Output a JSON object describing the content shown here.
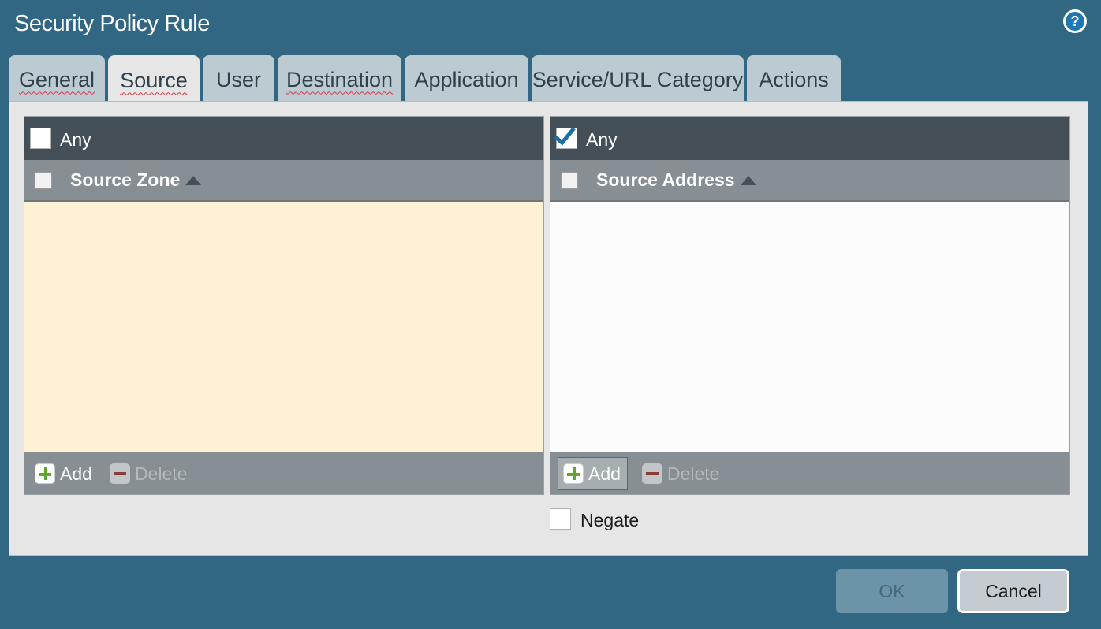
{
  "dialog": {
    "title": "Security Policy Rule"
  },
  "icons": {
    "help": "question-circle",
    "add": "plus",
    "delete": "minus",
    "sort": "triangle-up"
  },
  "tabs": [
    {
      "label": "General",
      "active": false,
      "has_error": true
    },
    {
      "label": "Source",
      "active": true,
      "has_error": true
    },
    {
      "label": "User",
      "active": false,
      "has_error": false
    },
    {
      "label": "Destination",
      "active": false,
      "has_error": true
    },
    {
      "label": "Application",
      "active": false,
      "has_error": false
    },
    {
      "label": "Service/URL Category",
      "active": false,
      "has_error": false
    },
    {
      "label": "Actions",
      "active": false,
      "has_error": false
    }
  ],
  "source_zone": {
    "any_label": "Any",
    "any_checked": false,
    "column_title": "Source Zone",
    "rows": [],
    "add_label": "Add",
    "delete_label": "Delete"
  },
  "source_address": {
    "any_label": "Any",
    "any_checked": true,
    "column_title": "Source Address",
    "rows": [],
    "add_label": "Add",
    "delete_label": "Delete"
  },
  "negate": {
    "label": "Negate",
    "checked": false
  },
  "buttons": {
    "ok_label": "OK",
    "cancel_label": "Cancel"
  },
  "colors": {
    "background": "#326784",
    "header_bar": "#444f58",
    "column_bar": "#878f95",
    "required_list_bg": "#fff1d4",
    "checkbox_check": "#1c6fa3",
    "add_icon": "#5eaa28"
  }
}
